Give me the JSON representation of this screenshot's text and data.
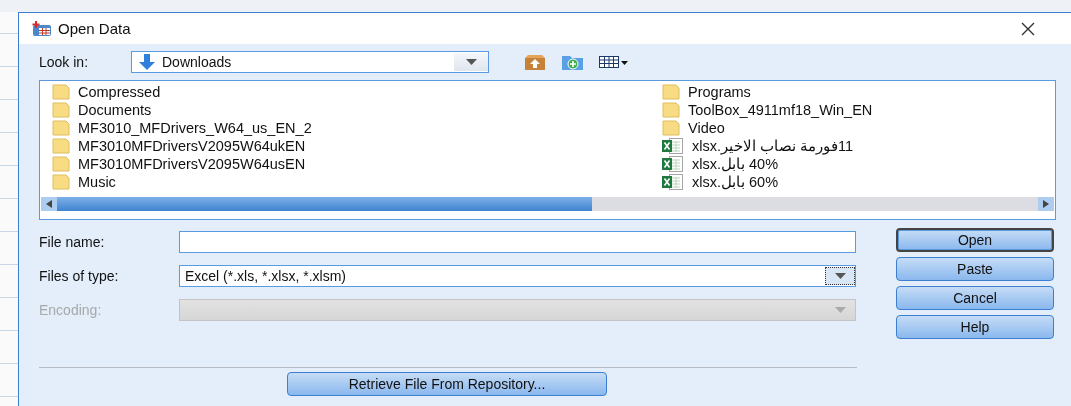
{
  "window": {
    "title": "Open Data"
  },
  "look_in": {
    "label": "Look in:",
    "value": "Downloads"
  },
  "files": [
    {
      "name": "Compressed",
      "kind": "folder"
    },
    {
      "name": "Documents",
      "kind": "folder"
    },
    {
      "name": "MF3010_MFDrivers_W64_us_EN_2",
      "kind": "folder"
    },
    {
      "name": "MF3010MFDriversV2095W64ukEN",
      "kind": "folder"
    },
    {
      "name": "MF3010MFDriversV2095W64usEN",
      "kind": "folder"
    },
    {
      "name": "Music",
      "kind": "folder"
    },
    {
      "name": "Programs",
      "kind": "folder"
    },
    {
      "name": "ToolBox_4911mf18_Win_EN",
      "kind": "folder"
    },
    {
      "name": "Video",
      "kind": "folder"
    },
    {
      "name": "11فورمة نصاب الاخير.xlsx",
      "kind": "excel"
    },
    {
      "name": "40% بابل.xlsx",
      "kind": "excel"
    },
    {
      "name": "60% بابل.xlsx",
      "kind": "excel"
    }
  ],
  "fields": [
    {
      "label": "File name:",
      "kind": "text",
      "disabled": false
    },
    {
      "label": "Files of type:",
      "kind": "dropdown",
      "value": "Excel (*.xls, *.xlsx, *.xlsm)",
      "disabled": false
    },
    {
      "label": "Encoding:",
      "kind": "dropdown",
      "disabled": true
    }
  ],
  "buttons": [
    {
      "label": "Open",
      "default": true
    },
    {
      "label": "Paste",
      "default": false
    },
    {
      "label": "Cancel",
      "default": false
    },
    {
      "label": "Help",
      "default": false
    }
  ],
  "repository_button": {
    "label": "Retrieve File From Repository..."
  }
}
